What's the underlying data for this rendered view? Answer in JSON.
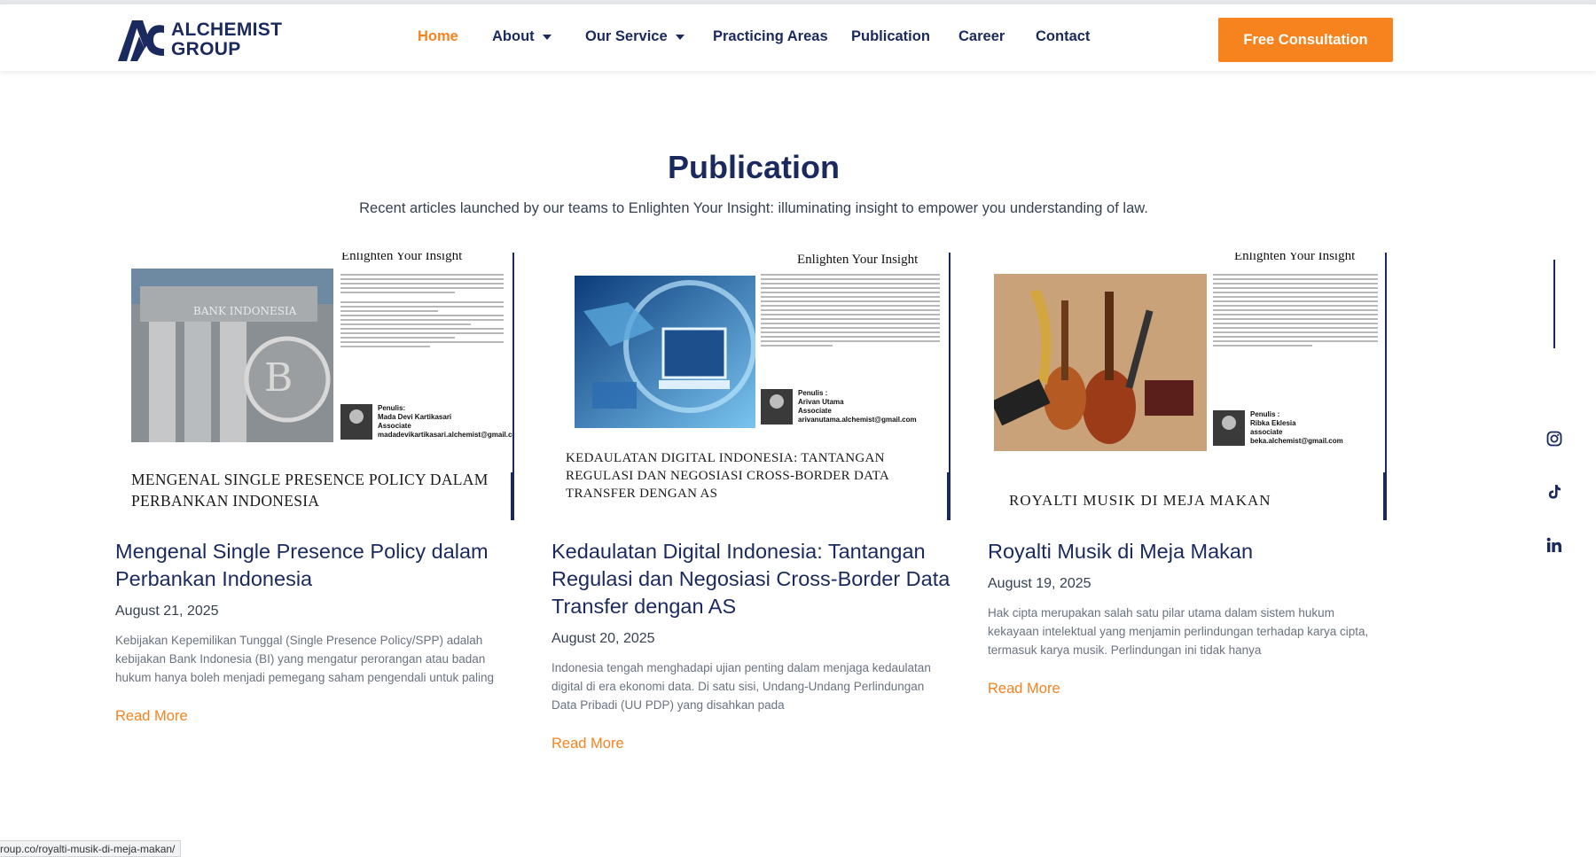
{
  "brand": {
    "line1": "ALCHEMIST",
    "line2": "GROUP",
    "color": "#1b2a5e",
    "accent": "#f7831f"
  },
  "nav": {
    "items": [
      {
        "label": "Home",
        "active": true
      },
      {
        "label": "About",
        "dropdown": true
      },
      {
        "label": "Our Service",
        "dropdown": true
      },
      {
        "label": "Practicing Areas"
      },
      {
        "label": "Publication"
      },
      {
        "label": "Career"
      },
      {
        "label": "Contact"
      }
    ],
    "cta": "Free Consultation"
  },
  "section": {
    "title": "Publication",
    "subtitle": "Recent articles launched by our teams to Enlighten Your Insight: illuminating insight to empower you understanding of law."
  },
  "posts": [
    {
      "thumb_header": "Enlighten Your Insight",
      "thumb_caption": "MENGENAL SINGLE PRESENCE POLICY DALAM PERBANKAN INDONESIA",
      "thumb_author": {
        "label": "Penulis:",
        "name": "Mada Devi Kartikasari",
        "role": "Associate",
        "email": "madadevikartikasari.alchemist@gmail.com"
      },
      "title": "Mengenal Single Presence Policy dalam Perbankan Indonesia",
      "date": "August 21, 2025",
      "excerpt": "Kebijakan Kepemilikan Tunggal (Single Presence Policy/SPP) adalah kebijakan Bank Indonesia (BI) yang mengatur perorangan atau badan hukum hanya boleh menjadi pemegang saham pengendali untuk paling",
      "read_more": "Read More"
    },
    {
      "thumb_header": "Enlighten Your Insight",
      "thumb_caption": "KEDAULATAN DIGITAL INDONESIA: TANTANGAN REGULASI DAN NEGOSIASI CROSS-BORDER DATA TRANSFER DENGAN AS",
      "thumb_author": {
        "label": "Penulis :",
        "name": "Arivan Utama",
        "role": "Associate",
        "email": "arivanutama.alchemist@gmail.com"
      },
      "title": "Kedaulatan Digital Indonesia: Tantangan Regulasi dan Negosiasi Cross-Border Data Transfer dengan AS",
      "date": "August 20, 2025",
      "excerpt": "Indonesia tengah menghadapi ujian penting dalam menjaga kedaulatan digital di era ekonomi data. Di satu sisi, Undang-Undang Perlindungan Data Pribadi (UU PDP) yang disahkan pada",
      "read_more": "Read More"
    },
    {
      "thumb_header": "Enlighten Your Insight",
      "thumb_caption": "ROYALTI MUSIK DI MEJA MAKAN",
      "thumb_author": {
        "label": "Penulis :",
        "name": "Ribka Eklesia",
        "role": "associate",
        "email": "beka.alchemist@gmail.com"
      },
      "title": "Royalti Musik di Meja Makan",
      "date": "August 19, 2025",
      "excerpt": "Hak cipta merupakan salah satu pilar utama dalam sistem hukum kekayaan intelektual yang menjamin perlindungan terhadap karya cipta, termasuk karya musik. Perlindungan ini tidak hanya",
      "read_more": "Read More"
    }
  ],
  "social": [
    "instagram-icon",
    "tiktok-icon",
    "linkedin-icon"
  ],
  "status_bar": "roup.co/royalti-musik-di-meja-makan/"
}
